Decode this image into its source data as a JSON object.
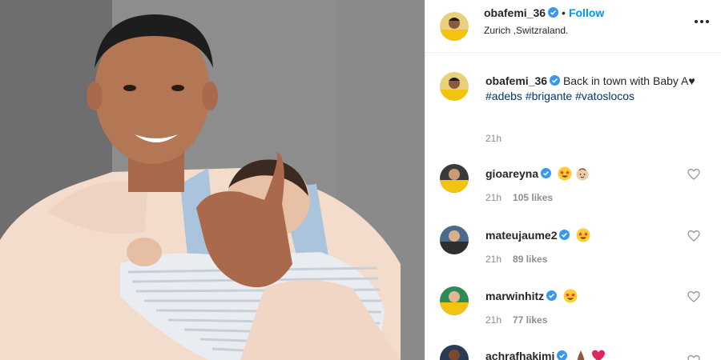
{
  "post": {
    "username": "obafemi_36",
    "follow_label": "Follow",
    "dot": "•",
    "location": "Zurich ,Switzraland.",
    "caption_text": "Back in town with Baby A♥",
    "hashtags": [
      "#adebs",
      "#brigante",
      "#vatoslocos"
    ],
    "caption_time": "21h"
  },
  "comments": [
    {
      "username": "gioareyna",
      "emojis": [
        "star-struck-emoji",
        "baby-emoji"
      ],
      "time": "21h",
      "likes": "105 likes"
    },
    {
      "username": "mateujaume2",
      "emojis": [
        "star-struck-emoji"
      ],
      "time": "21h",
      "likes": "89 likes"
    },
    {
      "username": "marwinhitz",
      "emojis": [
        "star-struck-emoji"
      ],
      "time": "21h",
      "likes": "77 likes"
    },
    {
      "username": "achrafhakimi",
      "emojis": [
        "praying-hands-emoji",
        "red-heart-emoji"
      ],
      "time": "",
      "likes": ""
    }
  ],
  "colors": {
    "link_blue": "#0095f6",
    "hashtag_blue": "#00376b",
    "meta_grey": "#8e8e8e",
    "verified_blue": "#3897f0"
  },
  "icons": {
    "verified": "verified-badge-icon",
    "more": "more-options-icon",
    "like": "heart-outline-icon"
  }
}
